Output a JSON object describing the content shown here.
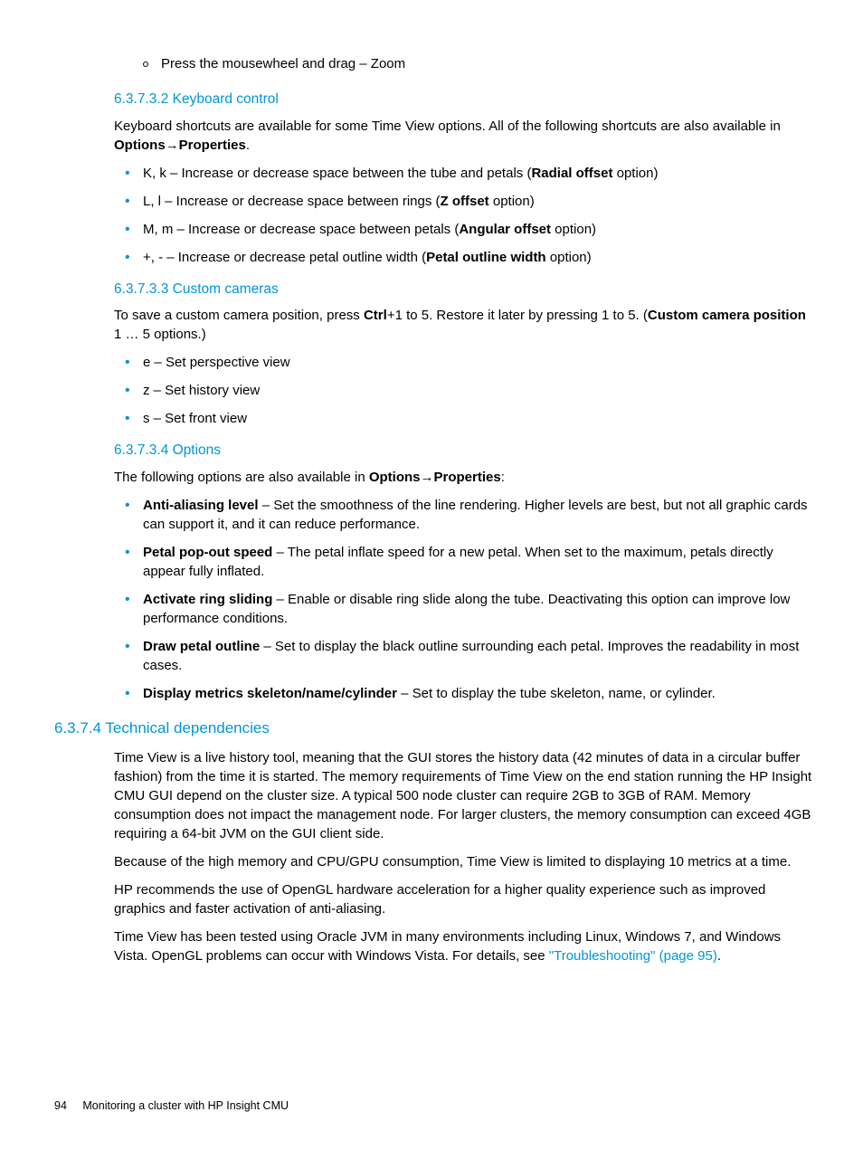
{
  "sub_bullet": "Press the mousewheel and drag – Zoom",
  "s1": {
    "heading": "6.3.7.3.2 Keyboard control",
    "intro_a": "Keyboard shortcuts are available for some Time View options. All of the following shortcuts are also available in ",
    "intro_b": "Options",
    "intro_arrow": "→",
    "intro_c": "Properties",
    "intro_d": ".",
    "items": [
      {
        "pre": "K, k – Increase or decrease space between the tube and petals (",
        "bold": "Radial offset",
        "post": " option)"
      },
      {
        "pre": "L, l – Increase or decrease space between rings (",
        "bold": "Z offset",
        "post": " option)"
      },
      {
        "pre": "M, m – Increase or decrease space between petals (",
        "bold": "Angular offset",
        "post": " option)"
      },
      {
        "pre": "+, - – Increase or decrease petal outline width (",
        "bold": "Petal outline width",
        "post": " option)"
      }
    ]
  },
  "s2": {
    "heading": "6.3.7.3.3 Custom cameras",
    "intro_a": "To save a custom camera position, press ",
    "intro_b": "Ctrl",
    "intro_c": "+1 to 5. Restore it later by pressing 1 to 5. (",
    "intro_d": "Custom camera position",
    "intro_e": " 1 … 5 options.)",
    "items": [
      "e – Set perspective view",
      "z – Set history view",
      "s – Set front view"
    ]
  },
  "s3": {
    "heading": "6.3.7.3.4 Options",
    "intro_a": "The following options are also available in ",
    "intro_b": "Options",
    "intro_arrow": "→",
    "intro_c": "Properties",
    "intro_d": ":",
    "items": [
      {
        "bold": "Anti-aliasing level",
        "rest": " – Set the smoothness of the line rendering. Higher levels are best, but not all graphic cards can support it, and it can reduce performance."
      },
      {
        "bold": "Petal pop-out speed",
        "rest": " – The petal inflate speed for a new petal. When set to the maximum, petals directly appear fully inflated."
      },
      {
        "bold": "Activate ring sliding",
        "rest": " – Enable or disable ring slide along the tube. Deactivating this option can improve low performance conditions."
      },
      {
        "bold": "Draw petal outline",
        "rest": " – Set to display the black outline surrounding each petal. Improves the readability in most cases."
      },
      {
        "bold": "Display metrics skeleton/name/cylinder",
        "rest": " – Set to display the tube skeleton, name, or cylinder."
      }
    ]
  },
  "s4": {
    "heading": "6.3.7.4 Technical dependencies",
    "p1": "Time View is a live history tool, meaning that the GUI stores the history data (42 minutes of data in a circular buffer fashion) from the time it is started. The memory requirements of Time View on the end station running the HP Insight CMU GUI depend on the cluster size. A typical 500 node cluster can require 2GB to 3GB of RAM. Memory consumption does not impact the management node. For larger clusters, the memory consumption can exceed 4GB requiring a 64-bit JVM on the GUI client side.",
    "p2": "Because of the high memory and CPU/GPU consumption, Time View is limited to displaying 10 metrics at a time.",
    "p3": "HP recommends the use of OpenGL hardware acceleration for a higher quality experience such as improved graphics and faster activation of anti-aliasing.",
    "p4a": "Time View has been tested using Oracle JVM in many environments including Linux, Windows 7, and Windows Vista. OpenGL problems can occur with Windows Vista. For details, see ",
    "p4link": "\"Troubleshooting\" (page 95)",
    "p4b": "."
  },
  "footer": {
    "page": "94",
    "title": "Monitoring a cluster with HP Insight CMU"
  }
}
